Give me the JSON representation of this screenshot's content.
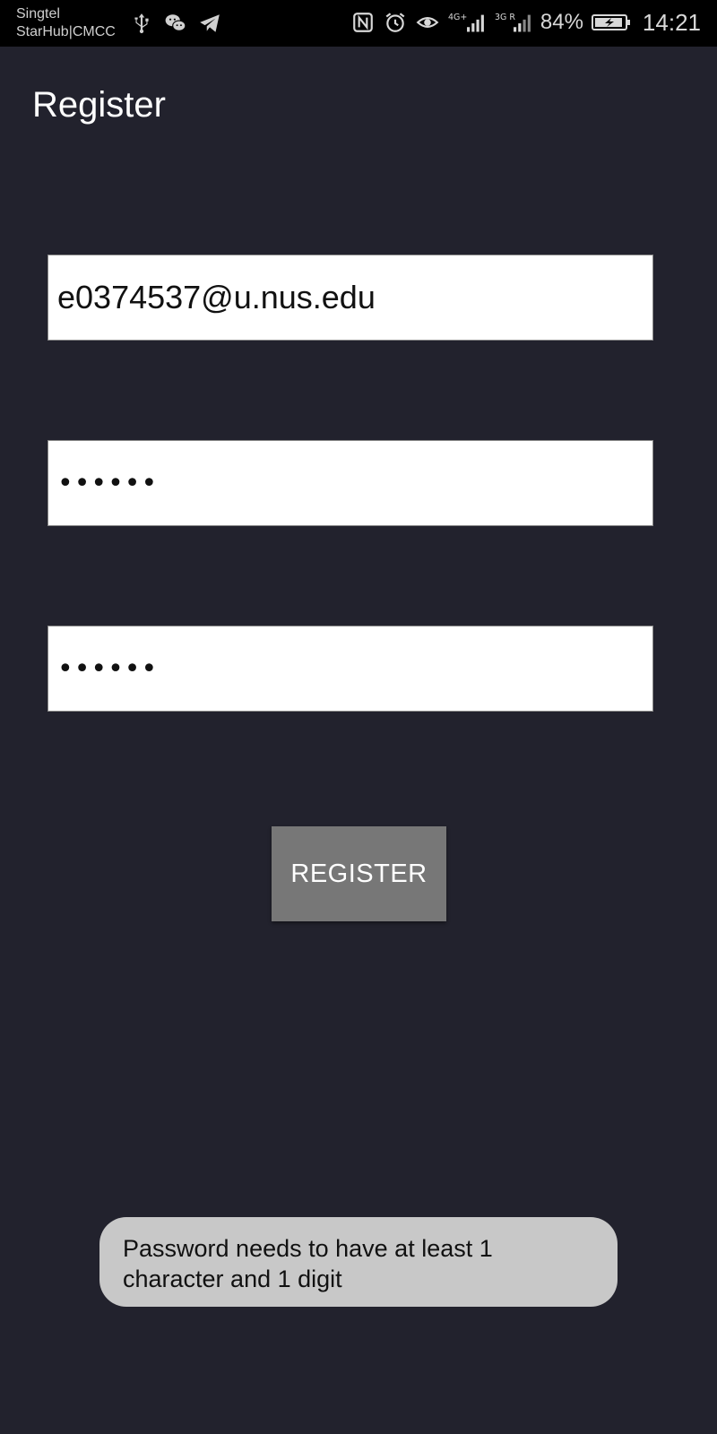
{
  "status_bar": {
    "carrier_line1": "Singtel",
    "carrier_line2": "StarHub|CMCC",
    "left_icons": [
      "usb-icon",
      "wechat-icon",
      "telegram-icon"
    ],
    "right_icons": [
      "nfc-icon",
      "alarm-icon",
      "eye-icon",
      "signal-4g-icon",
      "signal-3g-icon",
      "battery-charging-icon"
    ],
    "battery": "84%",
    "time": "14:21"
  },
  "page": {
    "title": "Register"
  },
  "form": {
    "email_value": "e0374537@u.nus.edu",
    "password_value": "••••••",
    "confirm_password_value": "••••••",
    "register_label": "REGISTER"
  },
  "toast": {
    "message": "Password needs to have at least 1 character and 1 digit"
  },
  "colors": {
    "background": "#22222d",
    "status_bar": "#000000",
    "button": "#777777",
    "toast": "#c8c8c8"
  }
}
